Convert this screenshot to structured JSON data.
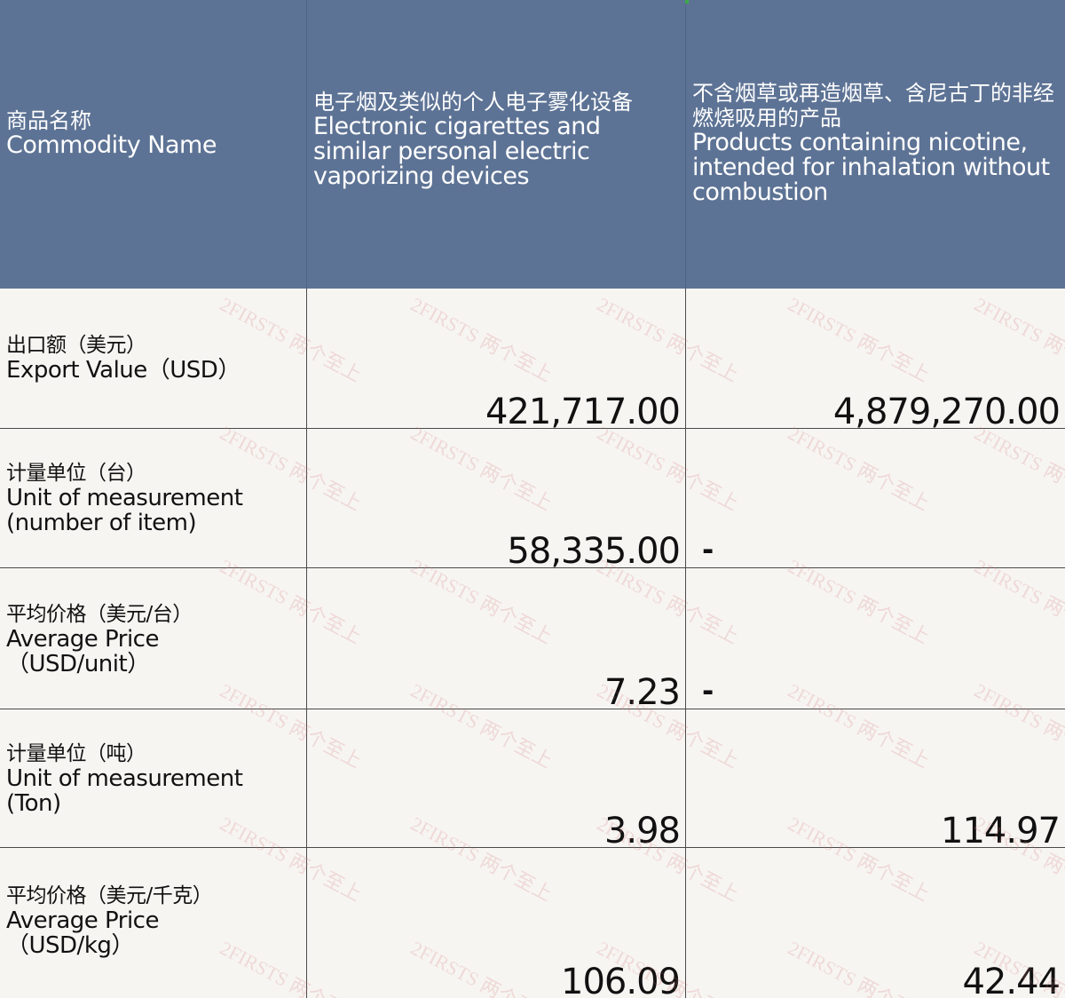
{
  "header": {
    "col1": {
      "cn": "商品名称",
      "en": "Commodity Name"
    },
    "col2": {
      "cn": "电子烟及类似的个人电子雾化设备",
      "en": "Electronic cigarettes and similar personal electric vaporizing devices"
    },
    "col3": {
      "cn": "不含烟草或再造烟草、含尼古丁的非经燃烧吸用的产品",
      "en": "Products containing nicotine, intended for inhalation without combustion"
    }
  },
  "rows": [
    {
      "cn": "出口额（美元）",
      "en": " Export Value（USD）",
      "col2": "421,717.00",
      "col3": "4,879,270.00"
    },
    {
      "cn": "计量单位（台）",
      "en": "Unit of measurement\n(number of item)",
      "col2": "58,335.00",
      "col3": "-"
    },
    {
      "cn": "平均价格（美元/台）",
      "en": "Average Price\n （USD/unit）",
      "col2": "7.23",
      "col3": "-"
    },
    {
      "cn": "计量单位（吨）",
      "en": "Unit of measurement\n(Ton)",
      "col2": "3.98",
      "col3": "114.97"
    },
    {
      "cn": "平均价格（美元/千克）",
      "en": "Average Price\n （USD/kg）",
      "col2": "106.09",
      "col3": "42.44"
    }
  ],
  "watermark": {
    "text": "2FIRSTS 两个至上",
    "color": "#d27878"
  },
  "colors": {
    "header_bg": "#5d7395",
    "body_bg": "#f7f5f2",
    "border": "#4a4a4a"
  }
}
